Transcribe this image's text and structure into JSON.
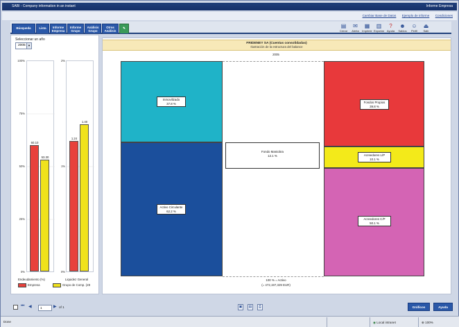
{
  "window": {
    "title": "SABI - Company information in an instant",
    "brand": "Informe Empresa"
  },
  "links": [
    "Cambiar Base de Datos",
    "Ejemplo de informe",
    "Condiciones"
  ],
  "tabs": [
    {
      "label": "Búsqueda",
      "line2": ""
    },
    {
      "label": "Lista",
      "line2": ""
    },
    {
      "label": "Informe",
      "line2": "Empresa"
    },
    {
      "label": "Informe",
      "line2": "Grupo"
    },
    {
      "label": "Análisis",
      "line2": "Grupo"
    },
    {
      "label": "Otros",
      "line2": "Análisis"
    }
  ],
  "tools": [
    {
      "label": "Cerrar",
      "icon": "folder-icon"
    },
    {
      "label": "Alerta",
      "icon": "alert-icon"
    },
    {
      "label": "Imprimir",
      "icon": "print-icon"
    },
    {
      "label": "Exportar",
      "icon": "export-icon"
    },
    {
      "label": "Ayuda",
      "icon": "help-icon"
    },
    {
      "label": "Sabios",
      "icon": "users-icon"
    },
    {
      "label": "Perfil",
      "icon": "profile-icon"
    },
    {
      "label": "Salir",
      "icon": "exit-icon"
    }
  ],
  "left": {
    "select_label": "Seleccionar un año",
    "year": "2005",
    "endeudamiento": {
      "caption": "Endeudamiento (%)"
    },
    "liquidez": {
      "caption": "Liquidez General"
    },
    "legend": {
      "empresa": "Empresa",
      "grupo": "Grupo de Comp. (28"
    }
  },
  "colors": {
    "empresa": "#e8413c",
    "grupo": "#f0e21c",
    "inmovilizado": "#1fb3c8",
    "activo_circulante": "#1b4f9c",
    "fondos_propios": "#e8393b",
    "acreedores_lp": "#f3ea1a",
    "acreedores_cp": "#d464b4"
  },
  "main": {
    "company": "FRIDENEY SA (Cuentas consolidadas)",
    "subtitle": "Ilustración de la estructura del balance",
    "year": "2005",
    "total_line1": "100 % = Activo",
    "total_line2": "(= 472,197,329 EUR)"
  },
  "chart_data": [
    {
      "type": "bar",
      "categories": [
        "Endeudamiento (%)"
      ],
      "series": [
        {
          "name": "Empresa",
          "values": [
            60.1
          ]
        },
        {
          "name": "Grupo de Comp. (28",
          "values": [
            53.3
          ]
        }
      ],
      "value_labels": [
        "60.10",
        "53.30"
      ],
      "ylim": [
        0,
        100
      ],
      "yticks": [
        "0%",
        "25%",
        "50%",
        "75%",
        "100%"
      ]
    },
    {
      "type": "bar",
      "categories": [
        "Liquidez General"
      ],
      "series": [
        {
          "name": "Empresa",
          "values": [
            1.24
          ]
        },
        {
          "name": "Grupo de Comp. (28",
          "values": [
            1.4
          ]
        }
      ],
      "value_labels": [
        "1.24",
        "1.40"
      ],
      "ylim": [
        0,
        2
      ],
      "yticks": [
        "0%",
        "1%",
        "2%"
      ]
    },
    {
      "type": "bar",
      "title": "FRIDENEY SA (Cuentas consolidadas)",
      "subtitle": "Ilustración de la estructura del balance",
      "columns": [
        {
          "name": "Activo",
          "items": [
            {
              "label": "Inmovilizado",
              "value": "37.8 %",
              "pct": 37.8
            },
            {
              "label": "Activo Circulante",
              "value": "62.2 %",
              "pct": 62.2
            }
          ]
        },
        {
          "name": "Pasivo",
          "items": [
            {
              "label": "Fondos Propios",
              "value": "39.8 %",
              "pct": 39.8
            },
            {
              "label": "Acreedores L/P",
              "value": "10.1 %",
              "pct": 10.1
            },
            {
              "label": "Acreedores C/P",
              "value": "50.1 %",
              "pct": 50.1
            }
          ]
        }
      ],
      "middle": {
        "label": "Fondo Maniobra",
        "value": "12.1 %",
        "pct": 12.1
      }
    }
  ],
  "pager": {
    "page": "1",
    "of": "of 1"
  },
  "buttons": {
    "graficos": "Gráficos",
    "ayuda": "Ayuda"
  },
  "status": {
    "left": "Done",
    "zone": "Local intranet",
    "zoom": "100%"
  }
}
